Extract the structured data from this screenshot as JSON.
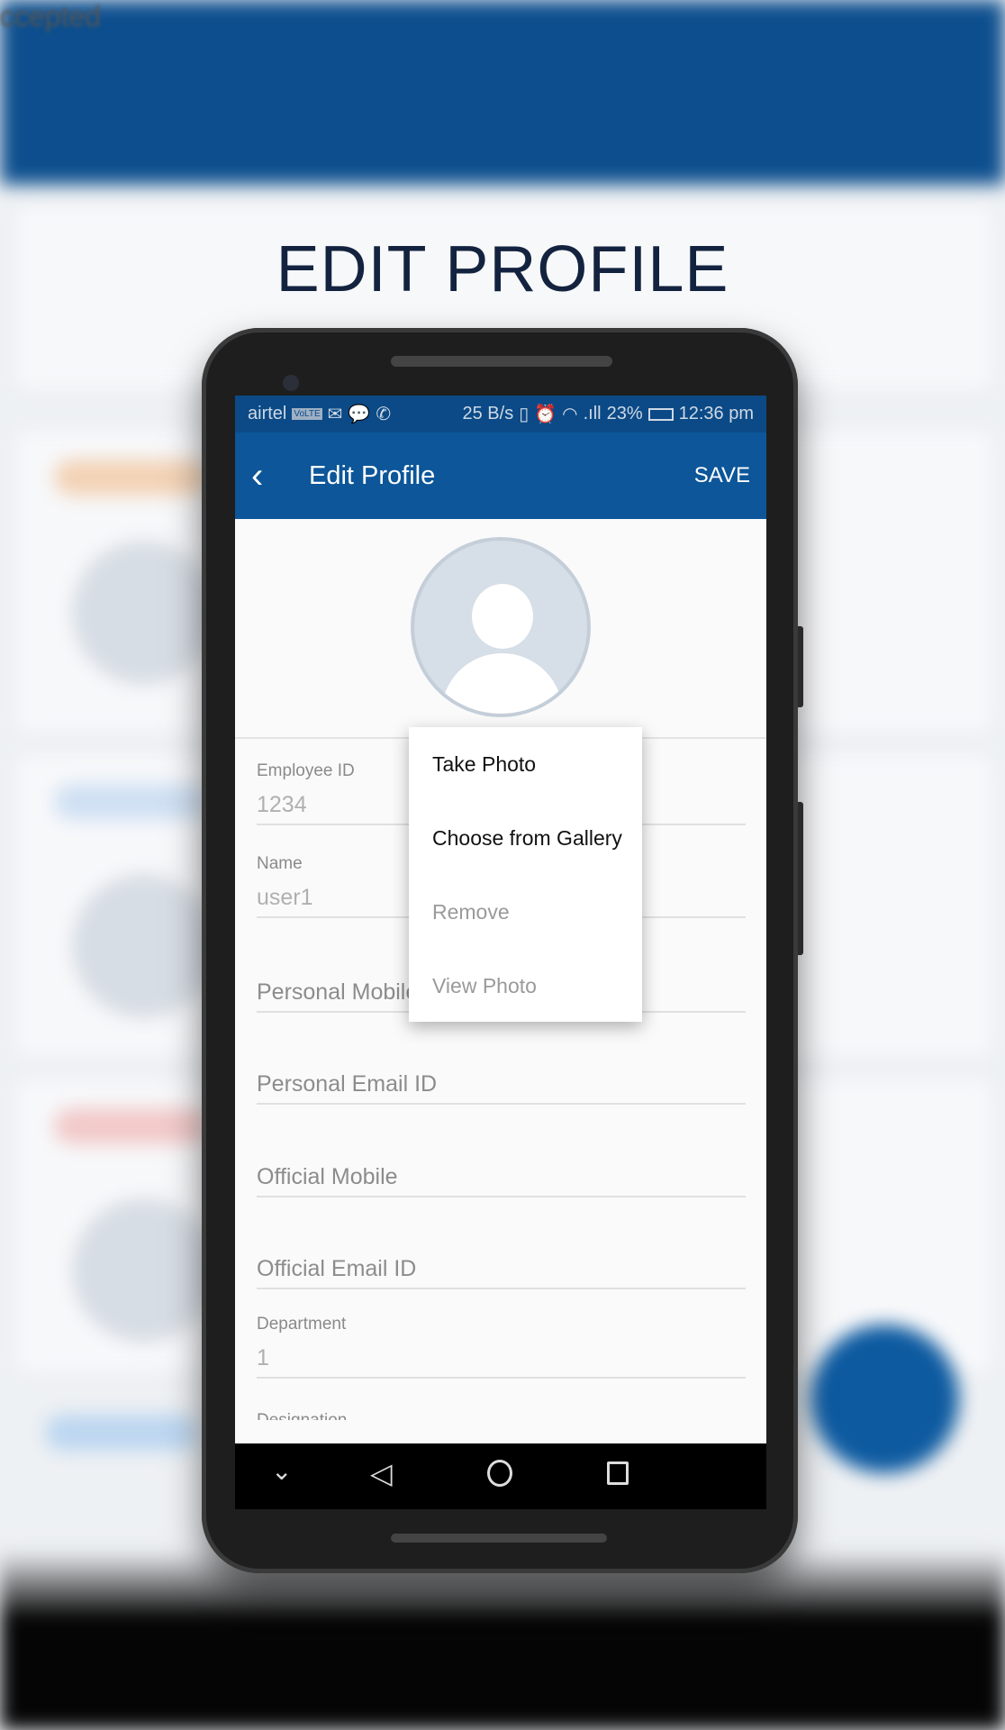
{
  "headline": "EDIT PROFILE",
  "background": {
    "partial_label": "ccepted"
  },
  "status_bar": {
    "carrier": "airtel",
    "volte": "VoLTE",
    "speed": "25 B/s",
    "signal": ".ıll",
    "battery": "23%",
    "time": "12:36 pm"
  },
  "app_bar": {
    "title": "Edit Profile",
    "save_label": "SAVE",
    "back_icon": "chevron-left-icon"
  },
  "form": {
    "employee_id": {
      "label": "Employee ID",
      "value": "1234"
    },
    "name": {
      "label": "Name",
      "value": "user1"
    },
    "personal_mobile": {
      "placeholder": "Personal Mobile"
    },
    "personal_email": {
      "placeholder": "Personal Email ID"
    },
    "official_mobile": {
      "placeholder": "Official Mobile"
    },
    "official_email": {
      "placeholder": "Official Email ID"
    },
    "department": {
      "label": "Department",
      "value": "1"
    },
    "designation": {
      "label": "Designation"
    }
  },
  "photo_menu": {
    "items": [
      {
        "label": "Take Photo",
        "enabled": true
      },
      {
        "label": "Choose from Gallery",
        "enabled": true
      },
      {
        "label": "Remove",
        "enabled": false
      },
      {
        "label": "View Photo",
        "enabled": false
      }
    ]
  },
  "colors": {
    "primary": "#0c5699",
    "status_bar": "#0b4a86",
    "headline": "#13233f"
  }
}
